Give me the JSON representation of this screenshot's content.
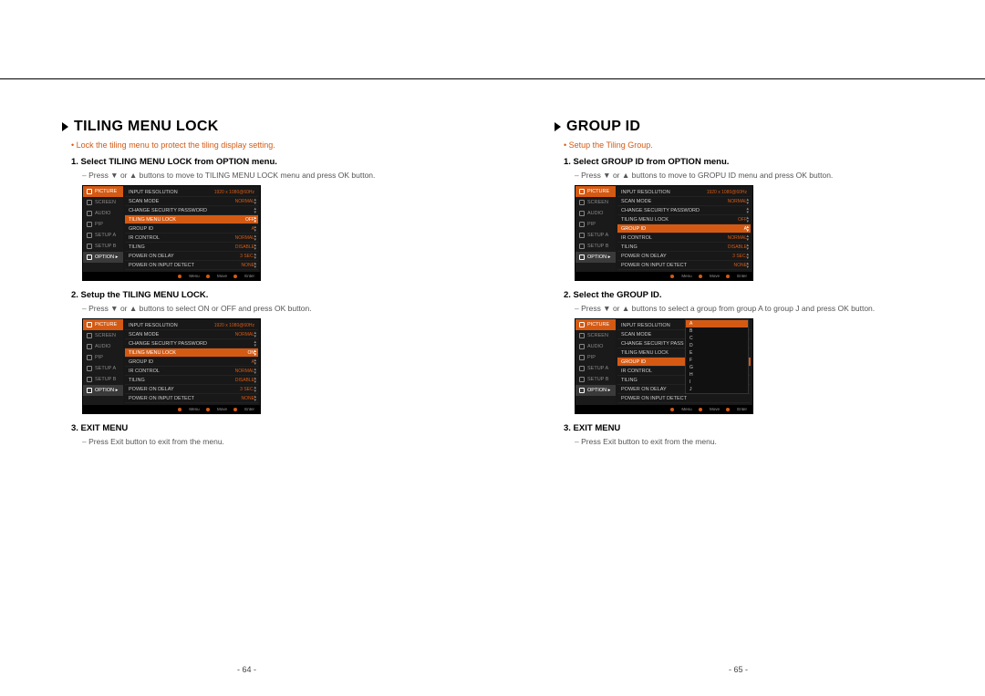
{
  "leftPage": {
    "title": "TILING MENU LOCK",
    "intro": "Lock the tiling menu to protect the tiling display setting.",
    "step1": "1.   Select TILING MENU LOCK from OPTION menu.",
    "step1sub": "Press ▼ or ▲ buttons to move to TILING MENU LOCK menu and press OK button.",
    "step2": "2.   Setup the TILING MENU LOCK.",
    "step2sub": "Press ▼ or ▲ buttons to select ON or OFF and press OK button.",
    "step3": "3.   EXIT MENU",
    "step3sub": "Press Exit button to exit from the menu.",
    "pagenum": "- 64 -"
  },
  "rightPage": {
    "title": "GROUP ID",
    "intro": "Setup the Tiling Group.",
    "step1": "1.   Select GROUP ID from OPTION menu.",
    "step1sub": "Press ▼ or ▲ buttons to move to GROPU ID menu and press OK button.",
    "step2": "2.   Select the GROUP ID.",
    "step2sub": "Press ▼ or ▲ buttons to select a group from group A to group J and press OK button.",
    "step3": "3.   EXIT MENU",
    "step3sub": "Press Exit button to exit from the menu.",
    "pagenum": "- 65 -"
  },
  "sideTabs": {
    "picture": "PICTURE",
    "screen": "SCREEN",
    "audio": "AUDIO",
    "pip": "PIP",
    "setupa": "SETUP A",
    "setupb": "SETUP B",
    "option": "OPTION ▸"
  },
  "menuRows": {
    "inputRes": "INPUT RESOLUTION",
    "inputResV": "1920 x 1080@60Hz",
    "scanMode": "SCAN MODE",
    "scanModeV": "NORMAL",
    "secPw": "CHANGE SECURITY PASSWORD",
    "tilingLock": "TILING MENU LOCK",
    "tilingLockOff": "OFF",
    "tilingLockOn": "ON",
    "groupId": "GROUP ID",
    "groupIdV": "A",
    "irControl": "IR CONTROL",
    "irControlV": "NORMAL",
    "tiling": "TILING",
    "tilingV": "DISABLE",
    "powerDelay": "POWER ON DELAY",
    "powerDelayV": "3 SEC.",
    "powerDetect": "POWER ON INPUT DETECT",
    "powerDetectV": "NONE"
  },
  "dropdown": {
    "a": "A",
    "b": "B",
    "c": "C",
    "d": "D",
    "e": "E",
    "f": "F",
    "g": "G",
    "h": "H",
    "i": "I",
    "j": "J"
  },
  "footer": {
    "menu": "Menu",
    "move": "Move",
    "enter": "Enter"
  }
}
